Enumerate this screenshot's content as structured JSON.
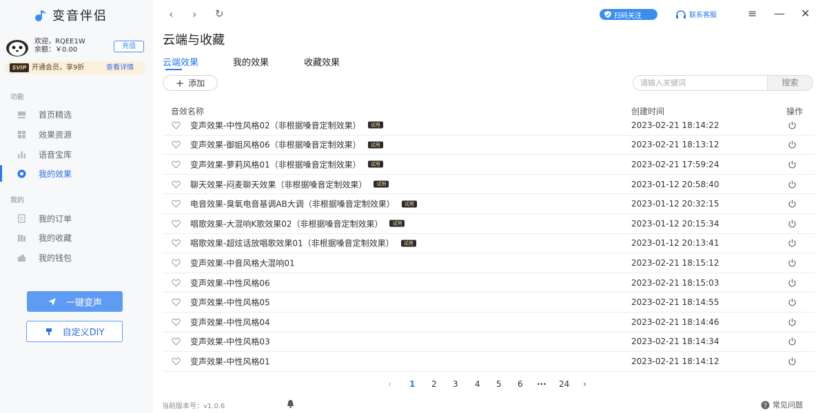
{
  "app": {
    "title": "变音伴侣",
    "accent_color": "#2b79ee"
  },
  "user": {
    "welcome": "欢迎，RQEE1W",
    "balance": "余额：￥0.00",
    "recharge_label": "充值"
  },
  "vip": {
    "badge": "SVIP",
    "text": "开通会员，享9折",
    "link": "查看详情"
  },
  "sidebar": {
    "section_functions": "功能",
    "function_items": [
      {
        "label": "首页精选",
        "icon": "home-icon"
      },
      {
        "label": "效果资源",
        "icon": "grid-icon"
      },
      {
        "label": "语音宝库",
        "icon": "bar-chart-icon"
      },
      {
        "label": "我的效果",
        "icon": "target-icon",
        "active": true
      }
    ],
    "section_mine": "我的",
    "mine_items": [
      {
        "label": "我的订单",
        "icon": "document-icon"
      },
      {
        "label": "我的收藏",
        "icon": "collection-icon"
      },
      {
        "label": "我的钱包",
        "icon": "wallet-icon"
      }
    ],
    "voice_button": "一键变声",
    "diy_button": "自定义DIY",
    "version": "当前版本号：v1.0.6"
  },
  "topbar": {
    "back_icon": "‹",
    "forward_icon": "›",
    "refresh_icon": "↻",
    "scan_label": "扫码关注",
    "support_label": "联系客服",
    "menu_icon": "≡",
    "minimize_icon": "—",
    "close_icon": "✕"
  },
  "main": {
    "title": "云端与收藏",
    "tabs": [
      "云端效果",
      "我的效果",
      "收藏效果"
    ],
    "add_label": "添加",
    "search_placeholder": "请输入关键词",
    "search_button": "搜索"
  },
  "table": {
    "columns": [
      "音效名称",
      "创建时间",
      "操作"
    ],
    "trial_label": "试用",
    "rows": [
      {
        "name": "变声效果-中性风格02（非根据嗓音定制效果）",
        "time": "2023-02-21 18:14:22",
        "trial": true
      },
      {
        "name": "变声效果-御姐风格06（非根据嗓音定制效果）",
        "time": "2023-02-21 18:13:12",
        "trial": true
      },
      {
        "name": "变声效果-萝莉风格01（非根据嗓音定制效果）",
        "time": "2023-02-21 17:59:24",
        "trial": true
      },
      {
        "name": "聊天效果-闷麦聊天效果（非根据嗓音定制效果）",
        "time": "2023-01-12 20:58:40",
        "trial": true
      },
      {
        "name": "电音效果-臭氧电音基调AB大调（非根据嗓音定制效果）",
        "time": "2023-01-12 20:32:15",
        "trial": true
      },
      {
        "name": "唱歌效果-大混响K歌效果02（非根据嗓音定制效果）",
        "time": "2023-01-12 20:15:34",
        "trial": true
      },
      {
        "name": "唱歌效果-超炫话放唱歌效果01（非根据嗓音定制效果）",
        "time": "2023-01-12 20:13:41",
        "trial": true
      },
      {
        "name": "变声效果-中音风格大混响01",
        "time": "2023-02-21 18:15:12",
        "trial": false
      },
      {
        "name": "变声效果-中性风格06",
        "time": "2023-02-21 18:15:03",
        "trial": false
      },
      {
        "name": "变声效果-中性风格05",
        "time": "2023-02-21 18:14:55",
        "trial": false
      },
      {
        "name": "变声效果-中性风格04",
        "time": "2023-02-21 18:14:46",
        "trial": false
      },
      {
        "name": "变声效果-中性风格03",
        "time": "2023-02-21 18:14:34",
        "trial": false
      },
      {
        "name": "变声效果-中性风格01",
        "time": "2023-02-21 18:14:12",
        "trial": false
      }
    ]
  },
  "pagination": {
    "prev": "‹",
    "pages": [
      "1",
      "2",
      "3",
      "4",
      "5",
      "6",
      "···",
      "24"
    ],
    "current": "1",
    "next": "›"
  },
  "footer": {
    "faq_label": "常见问题"
  }
}
